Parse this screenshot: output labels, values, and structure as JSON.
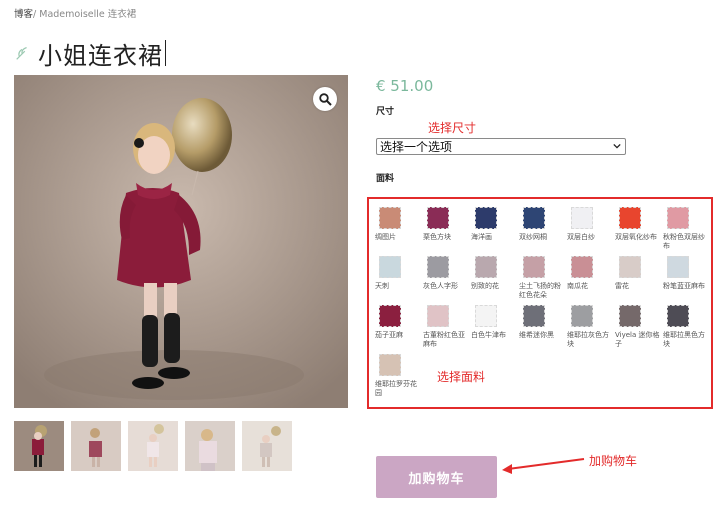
{
  "breadcrumb": {
    "home": "博客",
    "separator": "/",
    "current": "Mademoiselle 连衣裙"
  },
  "product": {
    "title": "小姐连衣裙",
    "price": "€ 51.00"
  },
  "size": {
    "label": "尺寸",
    "select_value": "选择一个选项"
  },
  "fabric": {
    "label": "面料",
    "swatches": [
      {
        "name": "绸图片",
        "color": "#c98b76"
      },
      {
        "name": "栗色方块",
        "color": "#8a2c56"
      },
      {
        "name": "海洋画",
        "color": "#2d3b6b"
      },
      {
        "name": "双纱网桐",
        "color": "#2e4574"
      },
      {
        "name": "双层白纱",
        "color": "#f0f0f3"
      },
      {
        "name": "双层氧化纱布",
        "color": "#e8452e"
      },
      {
        "name": "秋粉色双层纱布",
        "color": "#e09aa3"
      },
      {
        "name": "天刺",
        "color": "#c9d8de"
      },
      {
        "name": "灰色人字形",
        "color": "#9c9ba1"
      },
      {
        "name": "别致的花",
        "color": "#b9a8ae"
      },
      {
        "name": "尘土飞扬的粉红色花朵",
        "color": "#c5a0a6"
      },
      {
        "name": "南瓜花",
        "color": "#c98f95"
      },
      {
        "name": "雷花",
        "color": "#d8ccc8"
      },
      {
        "name": "粉笔蓝亚麻布",
        "color": "#cfd9e0"
      },
      {
        "name": "茄子亚麻",
        "color": "#8b1f3f"
      },
      {
        "name": "古董粉红色亚麻布",
        "color": "#e0c3c6"
      },
      {
        "name": "白色牛津布",
        "color": "#f4f4f4"
      },
      {
        "name": "维希迷你黑",
        "color": "#6e6f78"
      },
      {
        "name": "维耶拉灰色方块",
        "color": "#9d9ea1"
      },
      {
        "name": "Viyela 迷你格子",
        "color": "#75696a"
      },
      {
        "name": "维耶拉黑色方块",
        "color": "#4e4c55"
      },
      {
        "name": "维耶拉罗芬花园",
        "color": "#d6c2b4"
      }
    ]
  },
  "cart": {
    "button_label": "加购物车"
  },
  "annotations": {
    "size": "选择尺寸",
    "fabric": "选择面料",
    "cart": "加购物车"
  }
}
